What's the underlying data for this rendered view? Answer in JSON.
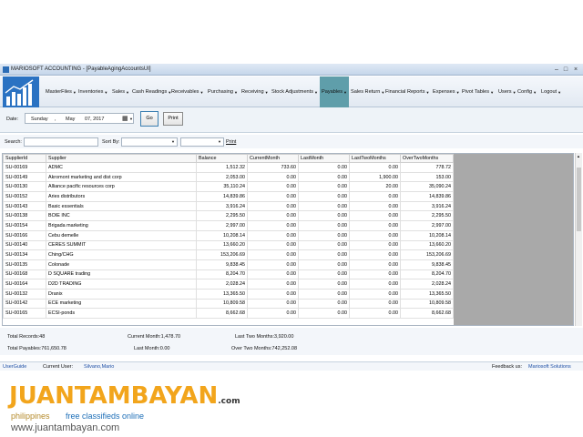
{
  "window": {
    "title": "MARIOSOFT ACCOUNTING - [PayableAgingAccountsUI]"
  },
  "menu": [
    {
      "label": "MasterFiles",
      "active": false
    },
    {
      "label": "Inventories",
      "active": false
    },
    {
      "label": "Sales",
      "active": false
    },
    {
      "label": "Cash Readings",
      "active": false
    },
    {
      "label": "Receivables",
      "active": false
    },
    {
      "label": "Purchasing",
      "active": false
    },
    {
      "label": "Receiving",
      "active": false
    },
    {
      "label": "Stock Adjustments",
      "active": false
    },
    {
      "label": "Payables",
      "active": true
    },
    {
      "label": "Sales Return",
      "active": false
    },
    {
      "label": "Financial Reports",
      "active": false
    },
    {
      "label": "Expenses",
      "active": false
    },
    {
      "label": "Pivot Tables",
      "active": false
    },
    {
      "label": "Users",
      "active": false
    },
    {
      "label": "Config",
      "active": false
    },
    {
      "label": "Logout",
      "active": false
    }
  ],
  "toolbar": {
    "date_label": "Date:",
    "date_weekday": "Sunday",
    "date_sep": ",",
    "date_month": "May",
    "date_value": "07, 2017",
    "go_label": "Go",
    "print_label": "Print"
  },
  "search": {
    "search_label": "Search:",
    "sortby_label": "Sort By:",
    "print_link": "Print"
  },
  "grid": {
    "columns": [
      "SupplierId",
      "Supplier",
      "Balance",
      "CurrentMonth",
      "LastMonth",
      "LastTwoMonths",
      "OverTwoMonths"
    ],
    "rows": [
      [
        "SU-00169",
        "ADMC",
        "1,512.32",
        "733.60",
        "0.00",
        "0.00",
        "778.72"
      ],
      [
        "SU-00149",
        "Akromont marketing and dist corp",
        "2,053.00",
        "0.00",
        "0.00",
        "1,900.00",
        "153.00"
      ],
      [
        "SU-00130",
        "Alliance pacific resources corp",
        "35,110.24",
        "0.00",
        "0.00",
        "20.00",
        "35,090.24"
      ],
      [
        "SU-00152",
        "Aries distributors",
        "14,839.86",
        "0.00",
        "0.00",
        "0.00",
        "14,839.86"
      ],
      [
        "SU-00143",
        "Basic essentials",
        "3,916.24",
        "0.00",
        "0.00",
        "0.00",
        "3,916.24"
      ],
      [
        "SU-00138",
        "BOIE INC",
        "2,295.50",
        "0.00",
        "0.00",
        "0.00",
        "2,295.50"
      ],
      [
        "SU-00154",
        "Brigada marketing",
        "2,997.00",
        "0.00",
        "0.00",
        "0.00",
        "2,997.00"
      ],
      [
        "SU-00166",
        "Cebu demelle",
        "10,208.14",
        "0.00",
        "0.00",
        "0.00",
        "10,208.14"
      ],
      [
        "SU-00140",
        "CERES SUMMIT",
        "13,660.20",
        "0.00",
        "0.00",
        "0.00",
        "13,660.20"
      ],
      [
        "SU-00134",
        "Ching/CHG",
        "153,206.69",
        "0.00",
        "0.00",
        "0.00",
        "153,206.69"
      ],
      [
        "SU-00135",
        "Colonade",
        "9,838.45",
        "0.00",
        "0.00",
        "0.00",
        "9,838.45"
      ],
      [
        "SU-00168",
        "D SQUARE trading",
        "8,204.70",
        "0.00",
        "0.00",
        "0.00",
        "8,204.70"
      ],
      [
        "SU-00164",
        "D2D TRADING",
        "2,028.24",
        "0.00",
        "0.00",
        "0.00",
        "2,028.24"
      ],
      [
        "SU-00132",
        "Dranix",
        "13,365.50",
        "0.00",
        "0.00",
        "0.00",
        "13,365.50"
      ],
      [
        "SU-00142",
        "ECE marketing",
        "10,809.58",
        "0.00",
        "0.00",
        "0.00",
        "10,809.58"
      ],
      [
        "SU-00165",
        "ECSI-ponds",
        "8,662.68",
        "0.00",
        "0.00",
        "0.00",
        "8,662.68"
      ]
    ]
  },
  "summary": {
    "total_records": "Total Records:48",
    "current_month": "Current Month:1,478.70",
    "last_two_months": "Last Two Months:3,920.00",
    "total_payables": "Total Payables:761,650.78",
    "last_month": "Last Month:0.00",
    "over_two_months": "Over Two Months:742,252.08"
  },
  "status": {
    "userguide": "UserGuide",
    "current_user_label": "Current User:",
    "current_user": "Silvano,Mario",
    "feedback_label": "Feedback us:",
    "feedback_link": "Mariosoft Solutions"
  },
  "watermark": {
    "brand": "JUANTAMBAYAN",
    "domain_suffix": ".com",
    "tagline_left": "philippines",
    "tagline_right": "free classifieds online",
    "url": "www.juantambayan.com"
  },
  "colors": {
    "active_menu": "#5f9eaa",
    "grid_empty": "#a9a9a9",
    "link": "#1e4fa5",
    "logo_bg": "#2a72c2"
  }
}
